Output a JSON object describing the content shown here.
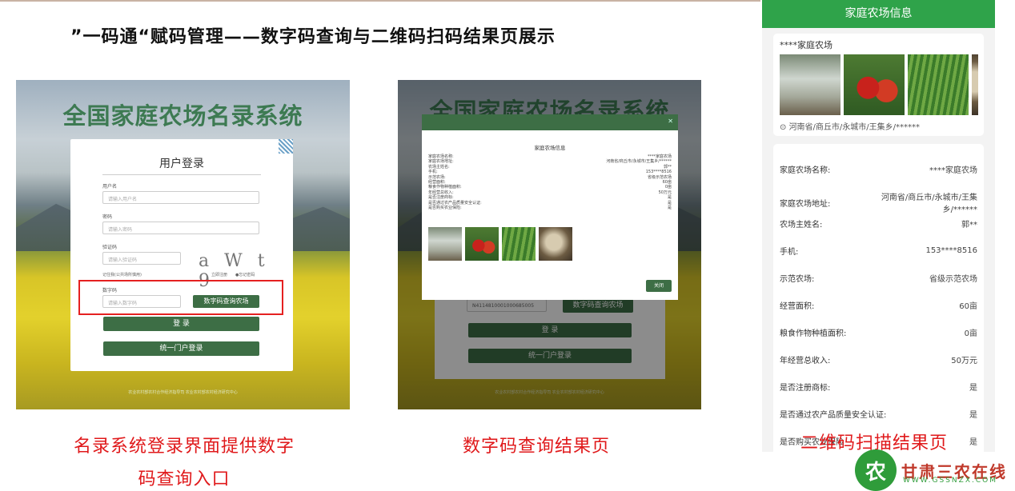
{
  "slide": {
    "title": "”一码通“赋码管理——数字码查询与二维码扫码结果页展示"
  },
  "login_panel": {
    "system_title": "全国家庭农场名录系统",
    "card_title": "用户登录",
    "username_label": "用户名",
    "username_placeholder": "请输入用户名",
    "password_label": "密码",
    "password_placeholder": "请输入密码",
    "captcha_label": "验证码",
    "captcha_placeholder": "请输入验证码",
    "captcha_text": "a W t 9",
    "remember_label": "记住我(公共场所慎用)",
    "register_link": "立即注册",
    "forgot_link": "●忘记密码",
    "digital_code_label": "数字码",
    "digital_code_placeholder": "请输入数字码",
    "query_button": "数字码查询农场",
    "login_button": "登 录",
    "portal_button": "统一门户登录",
    "footnote": "农业农村部农村合作经济指导司 农业农村部农村经济研究中心"
  },
  "result_panel": {
    "system_title": "全国家庭农场名录系统",
    "modal_title": "家庭农场信息",
    "rows": [
      {
        "k": "家庭农场名称:",
        "v": "****家庭农场"
      },
      {
        "k": "家庭农场地址:",
        "v": "河南省/商丘市/永城市/王集乡/******"
      },
      {
        "k": "农场主姓名:",
        "v": "郭**"
      },
      {
        "k": "手机:",
        "v": "153****8516"
      },
      {
        "k": "示范农场:",
        "v": "省级示范农场"
      },
      {
        "k": "经营面积:",
        "v": "60亩"
      },
      {
        "k": "粮食作物种植面积:",
        "v": "0亩"
      },
      {
        "k": "年经营总收入:",
        "v": "50万元"
      },
      {
        "k": "是否注册商标:",
        "v": "是"
      },
      {
        "k": "是否通过农产品质量安全认证:",
        "v": "是"
      },
      {
        "k": "是否购买农业保险:",
        "v": "是"
      }
    ],
    "close_button": "关闭",
    "code_value": "N4114810001000685005",
    "query_button": "数字码查询农场",
    "login_button": "登 录",
    "portal_button": "统一门户登录",
    "footnote": "农业农村部农村合作经济指导司 农业农村部农村经济研究中心"
  },
  "captions": {
    "left_line1": "名录系统登录界面提供数字",
    "left_line2": "码查询入口",
    "middle": "数字码查询结果页",
    "right": "二维码扫描结果页"
  },
  "mobile": {
    "header": "家庭农场信息",
    "farm_name": "****家庭农场",
    "location": "河南省/商丘市/永城市/王集乡/******",
    "rows": [
      {
        "k": "家庭农场名称:",
        "v": "****家庭农场"
      },
      {
        "k": "家庭农场地址:",
        "v": "河南省/商丘市/永城市/王集乡/******"
      },
      {
        "k": "农场主姓名:",
        "v": "郭**"
      },
      {
        "k": "手机:",
        "v": "153****8516"
      },
      {
        "k": "示范农场:",
        "v": "省级示范农场"
      },
      {
        "k": "经营面积:",
        "v": "60亩"
      },
      {
        "k": "粮食作物种植面积:",
        "v": "0亩"
      },
      {
        "k": "年经营总收入:",
        "v": "50万元"
      },
      {
        "k": "是否注册商标:",
        "v": "是"
      },
      {
        "k": "是否通过农产品质量安全认证:",
        "v": "是"
      },
      {
        "k": "是否购买农业保险",
        "v": "是"
      }
    ]
  },
  "logo": {
    "glyph": "农",
    "name": "甘肃三农在线",
    "url": "WWW.GSSNZX.COM"
  }
}
